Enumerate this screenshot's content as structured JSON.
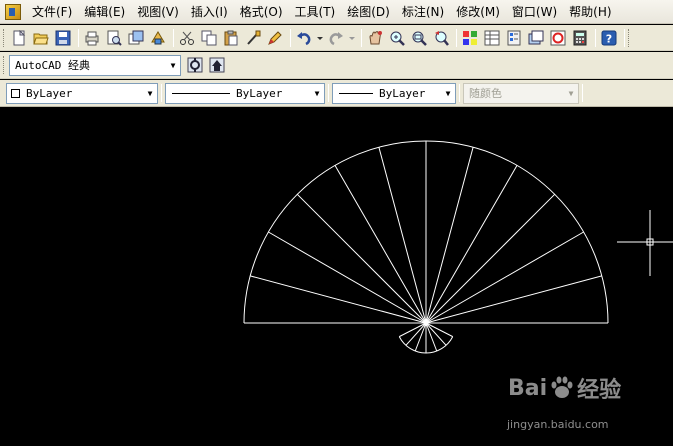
{
  "menubar": {
    "items": [
      "文件(F)",
      "编辑(E)",
      "视图(V)",
      "插入(I)",
      "格式(O)",
      "工具(T)",
      "绘图(D)",
      "标注(N)",
      "修改(M)",
      "窗口(W)",
      "帮助(H)"
    ]
  },
  "workspace": {
    "selected": "AutoCAD 经典"
  },
  "properties": {
    "color": "ByLayer",
    "linetype": "ByLayer",
    "lineweight": "ByLayer",
    "plotstyle": "随颜色"
  },
  "canvas": {
    "background": "#000000",
    "stroke": "#ffffff"
  },
  "watermark": {
    "brand": "Bai",
    "brand2": "经验",
    "site": "jingyan.baidu.com"
  }
}
